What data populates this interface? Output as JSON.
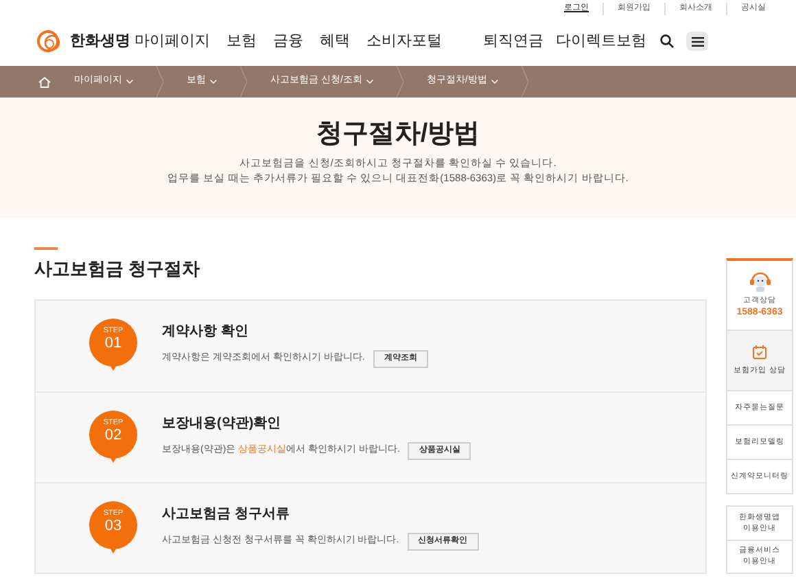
{
  "utility_links": [
    {
      "label": "로그인",
      "selected": true
    },
    {
      "label": "회원가입",
      "selected": false
    },
    {
      "label": "회사소개",
      "selected": false
    },
    {
      "label": "공시실",
      "selected": false
    }
  ],
  "logo": {
    "text": "한화생명"
  },
  "main_nav": [
    "마이페이지",
    "보험",
    "금융",
    "혜택",
    "소비자포털"
  ],
  "right_nav": [
    "퇴직연금",
    "다이렉트보험"
  ],
  "breadcrumb": [
    "마이페이지",
    "보험",
    "사고보험금 신청/조회",
    "청구절차/방법"
  ],
  "hero": {
    "title": "청구절차/방법",
    "lines": [
      "사고보험금을 신청/조회하시고 청구절차를 확인하실 수 있습니다.",
      "업무를 보실 때는 추가서류가 필요할 수 있으니 대표전화(1588-6363)로 꼭 확인하시기 바랍니다."
    ]
  },
  "section_title": "사고보험금 청구절차",
  "steps": [
    {
      "badge_label": "STEP",
      "number": "01",
      "title": "계약사항 확인",
      "description": [
        {
          "kind": "plain",
          "text": "계약사항은 계약조회에서 확인하시기 바랍니다."
        }
      ],
      "button": "계약조회"
    },
    {
      "badge_label": "STEP",
      "number": "02",
      "title": "보장내용(약관)확인",
      "description": [
        {
          "kind": "plain",
          "text": "보장내용(약관)은 "
        },
        {
          "kind": "link",
          "text": "상품공시실"
        },
        {
          "kind": "plain",
          "text": "에서 확인하시기 바랍니다."
        }
      ],
      "button": "상품공시실"
    },
    {
      "badge_label": "STEP",
      "number": "03",
      "title": "사고보험금 청구서류",
      "description": [
        {
          "kind": "plain",
          "text": "사고보험금 신청전 청구서류를 꼭 확인하시기 바랍니다."
        }
      ],
      "button": "신청서류확인"
    }
  ],
  "side_panel": {
    "contact_label": "고객상담",
    "contact_phone": "1588-6363",
    "items": [
      {
        "label": "보험가입 상담",
        "selected": true
      },
      {
        "label": "자주묻는질문",
        "selected": false
      },
      {
        "label": "보험리모델링",
        "selected": false
      },
      {
        "label": "신계약모니터링",
        "selected": false
      }
    ],
    "extra_items": [
      "한화생명앱 이용안내",
      "금융서비스 이용안내"
    ]
  }
}
